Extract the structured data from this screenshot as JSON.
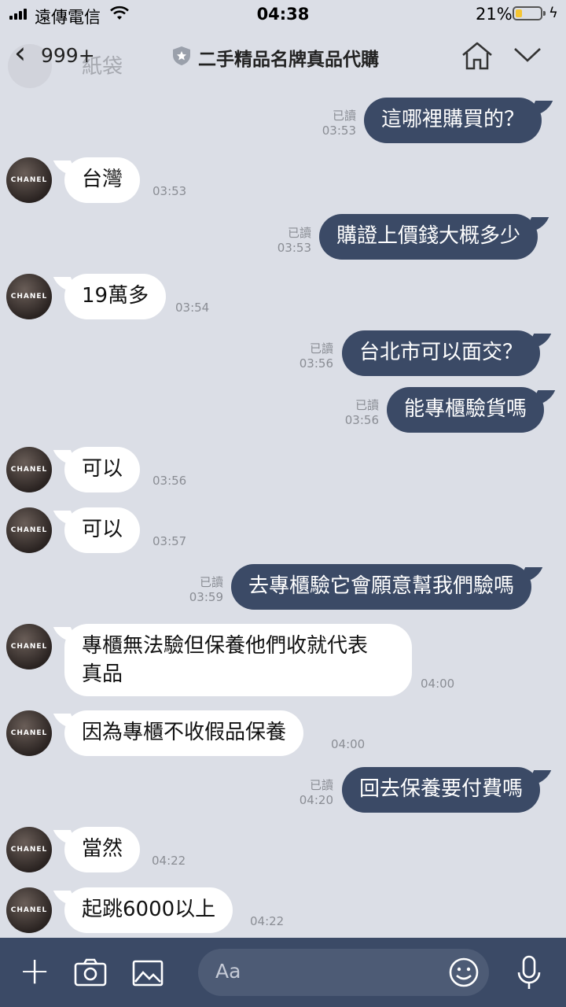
{
  "status_bar": {
    "carrier": "遠傳電信",
    "time": "04:38",
    "battery": "21%",
    "battery_level": 0.21
  },
  "header": {
    "back_count": "999+",
    "title": "二手精品名牌真品代購",
    "behind_text": "紙袋"
  },
  "contact": {
    "avatar_text": "CHANEL"
  },
  "messages": [
    {
      "side": "out",
      "text": "這哪裡購買的？",
      "read": "已讀",
      "time": "03:53"
    },
    {
      "side": "in",
      "text": "台灣",
      "time": "03:53"
    },
    {
      "side": "out",
      "text": "購證上價錢大概多少",
      "read": "已讀",
      "time": "03:53"
    },
    {
      "side": "in",
      "text": "19萬多",
      "time": "03:54"
    },
    {
      "side": "out",
      "text": "台北市可以面交？",
      "read": "已讀",
      "time": "03:56"
    },
    {
      "side": "out",
      "text": "能專櫃驗貨嗎",
      "read": "已讀",
      "time": "03:56"
    },
    {
      "side": "in",
      "text": "可以",
      "time": "03:56"
    },
    {
      "side": "in",
      "text": "可以",
      "time": "03:57"
    },
    {
      "side": "out",
      "text": "去專櫃驗它會願意幫我們驗嗎",
      "read": "已讀",
      "time": "03:59"
    },
    {
      "side": "in",
      "text": "專櫃無法驗但保養他們收就代表",
      "text2": "真品",
      "time": "04:00"
    },
    {
      "side": "in",
      "text": "因為專櫃不收假品保養",
      "time": "04:00"
    },
    {
      "side": "out",
      "text": "回去保養要付費嗎",
      "read": "已讀",
      "time": "04:20"
    },
    {
      "side": "in",
      "text": "當然",
      "time": "04:22"
    },
    {
      "side": "in",
      "text": "起跳6000以上",
      "time": "04:22"
    }
  ],
  "input_bar": {
    "placeholder": "Aa"
  }
}
